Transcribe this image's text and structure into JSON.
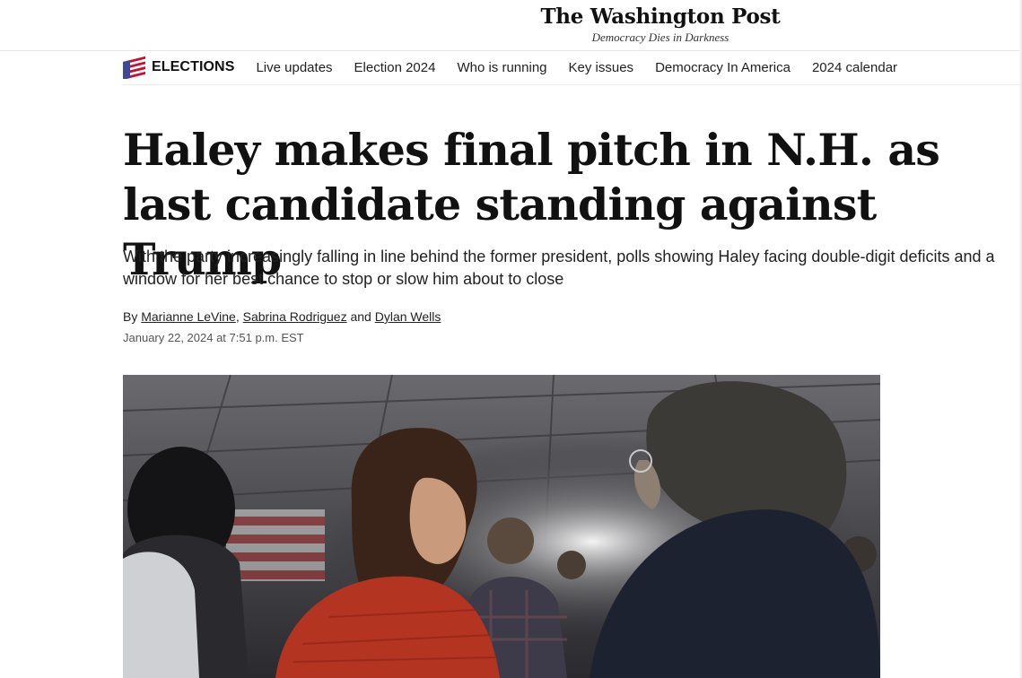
{
  "masthead": {
    "logo": "The Washington Post",
    "tagline": "Democracy Dies in Darkness"
  },
  "nav": {
    "section_label": "ELECTIONS",
    "links": [
      "Live updates",
      "Election 2024",
      "Who is running",
      "Key issues",
      "Democracy In America",
      "2024 calendar"
    ]
  },
  "article": {
    "headline": "Haley makes final pitch in N.H. as last candidate standing against Trump",
    "subhead": "With the party increasingly falling in line behind the former president, polls showing Haley facing double-digit deficits and a window for her best chance to stop or slow him about to close",
    "byline": {
      "prefix": "By",
      "authors": [
        "Marianne LeVine",
        "Sabrina Rodriguez",
        "Dylan Wells"
      ],
      "separator": ",",
      "conjunction": "and"
    },
    "timestamp": "January 22, 2024 at 7:51 p.m. EST"
  },
  "icons": {
    "section_icon": "american-flag-icon"
  },
  "colors": {
    "flag_blue": "#3a4a9c",
    "flag_red": "#c8102e",
    "text": "#111111"
  }
}
